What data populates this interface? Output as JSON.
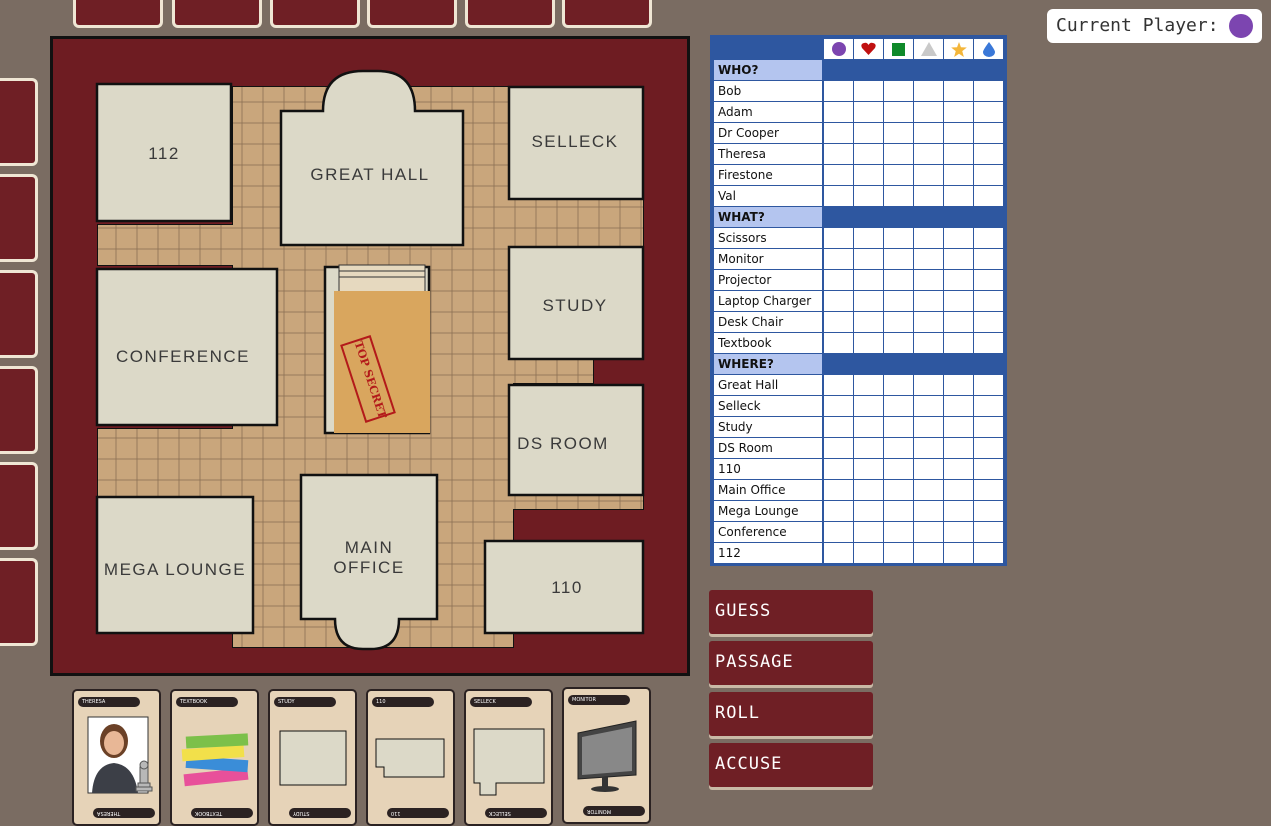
{
  "current_player": {
    "label": "Current Player:",
    "color": "#7c45b0"
  },
  "board": {
    "rooms": [
      "112",
      "GREAT HALL",
      "SELLECK",
      "STUDY",
      "CONFERENCE",
      "DS ROOM",
      "MEGA LOUNGE",
      "MAIN",
      "OFFICE",
      "110"
    ],
    "envelope_label": "TOP SECRET"
  },
  "notepad": {
    "players": [
      {
        "icon": "circle-icon",
        "color": "#7c45b0"
      },
      {
        "icon": "heart-icon",
        "color": "#c01010"
      },
      {
        "icon": "square-icon",
        "color": "#0f8a2a"
      },
      {
        "icon": "triangle-icon",
        "color": "#c9c9c9"
      },
      {
        "icon": "star-icon",
        "color": "#f4b63a"
      },
      {
        "icon": "drop-icon",
        "color": "#3a78d8"
      }
    ],
    "who_header": "WHO?",
    "who": [
      "Bob",
      "Adam",
      "Dr Cooper",
      "Theresa",
      "Firestone",
      "Val"
    ],
    "what_header": "WHAT?",
    "what": [
      "Scissors",
      "Monitor",
      "Projector",
      "Laptop Charger",
      "Desk Chair",
      "Textbook"
    ],
    "where_header": "WHERE?",
    "where": [
      "Great Hall",
      "Selleck",
      "Study",
      "DS Room",
      "110",
      "Main Office",
      "Mega Lounge",
      "Conference",
      "112"
    ]
  },
  "buttons": {
    "guess": "GUESS",
    "passage": "PASSAGE",
    "roll": "ROLL",
    "accuse": "ACCUSE"
  },
  "hand": [
    {
      "name": "THERESA",
      "kind": "person"
    },
    {
      "name": "TEXTBOOK",
      "kind": "weapon"
    },
    {
      "name": "STUDY",
      "kind": "room"
    },
    {
      "name": "110",
      "kind": "room"
    },
    {
      "name": "SELLECK",
      "kind": "room"
    },
    {
      "name": "MONITOR",
      "kind": "weapon"
    }
  ]
}
